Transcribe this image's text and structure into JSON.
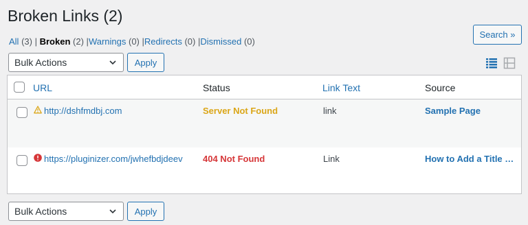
{
  "header": {
    "title": "Broken Links (2)"
  },
  "filters": [
    {
      "label": "All",
      "count": "(3)"
    },
    {
      "label": "Broken",
      "count": "(2)"
    },
    {
      "label": "Warnings",
      "count": "(0)"
    },
    {
      "label": "Redirects",
      "count": "(0)"
    },
    {
      "label": "Dismissed",
      "count": "(0)"
    }
  ],
  "search": {
    "button_label": "Search »"
  },
  "bulk_top": {
    "selected": "Bulk Actions",
    "apply_label": "Apply"
  },
  "bulk_bottom": {
    "selected": "Bulk Actions",
    "apply_label": "Apply"
  },
  "table": {
    "columns": {
      "url": "URL",
      "status": "Status",
      "link_text": "Link Text",
      "source": "Source"
    },
    "rows": [
      {
        "url": "http://dshfmdbj.com",
        "status": "Server Not Found",
        "link_text": "link",
        "source": "Sample Page",
        "status_icon": "warning-icon",
        "status_color": "#dba617"
      },
      {
        "url": "https://pluginizer.com/jwhefbdjdeev",
        "status": "404 Not Found",
        "link_text": "Link",
        "source": "How to Add a Title …",
        "status_icon": "error-icon",
        "status_color": "#d63638"
      }
    ]
  },
  "colors": {
    "link": "#2271b1",
    "warning": "#dba617",
    "error": "#d63638"
  }
}
